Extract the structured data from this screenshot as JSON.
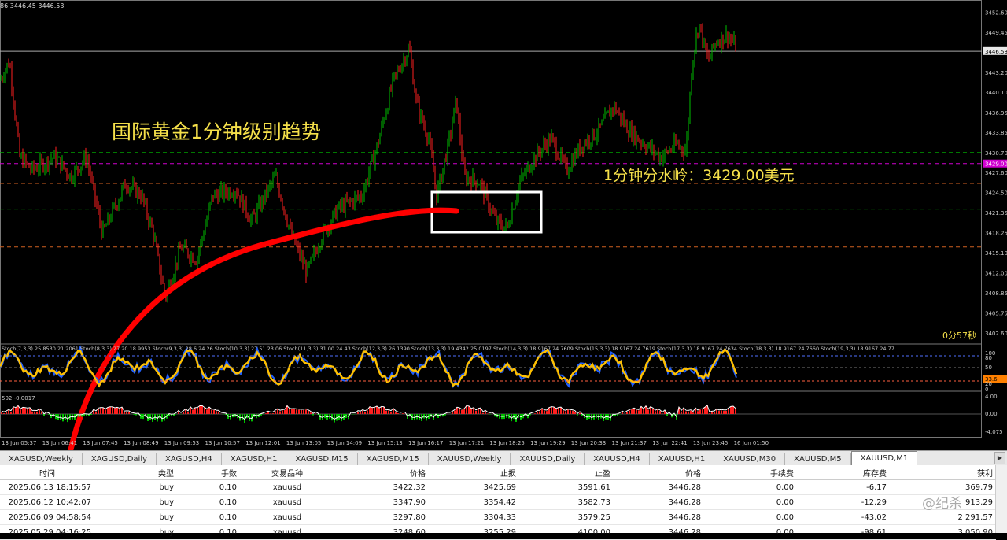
{
  "chart": {
    "top_info": "86 3446.45 3446.53",
    "annotation_title": "国际黄金1分钟级别趋势",
    "annotation_level": "1分钟分水岭：3429.00美元",
    "countdown": "0分57秒",
    "price_axis_labels": [
      "3452.60",
      "3449.45",
      "3446.53",
      "3443.20",
      "3440.10",
      "3436.95",
      "3433.85",
      "3430.70",
      "3429.00",
      "3427.60",
      "3424.50",
      "3421.35",
      "3418.25",
      "3415.10",
      "3412.00",
      "3408.85",
      "3405.75",
      "3402.60"
    ],
    "current_price": "3446.53",
    "level_price": "3429.00",
    "time_labels": [
      "13 Jun 05:37",
      "13 Jun 06:41",
      "13 Jun 07:45",
      "13 Jun 08:49",
      "13 Jun 09:53",
      "13 Jun 10:57",
      "13 Jun 12:01",
      "13 Jun 13:05",
      "13 Jun 14:09",
      "13 Jun 15:13",
      "13 Jun 16:17",
      "13 Jun 17:21",
      "13 Jun 18:25",
      "13 Jun 19:29",
      "13 Jun 20:33",
      "13 Jun 21:37",
      "13 Jun 22:41",
      "13 Jun 23:45",
      "16 Jun 01:50"
    ],
    "stoch_header": "Stoch(7,3,3) 25.8530 21.2061  Stoch(8,3,3) 27.20 18.9953  Stoch(9,3,3) 28.6 24.26  Stoch(10,3,3) 27.51 23.06  Stoch(11,3,3) 31.00 24.43  Stoch(12,3,3) 26.1390  Stoch(13,3,3) 19.4342 25.0197  Stoch(14,3,3) 18.9167 24.7609  Stoch(15,3,3) 18.9167 24.7619  Stoch(17,3,3) 18.9167 24.7634  Stoch(18,3,3) 18.9167 24.7660  Stoch(19,3,3) 18.9167 24.77",
    "stoch_axis": [
      "100",
      "80",
      "50",
      "33.6",
      "20",
      "0"
    ],
    "macd_header": "502 -0.0017",
    "macd_axis": [
      "4.00",
      "0.00",
      "-4.075"
    ],
    "colors": {
      "bull": "#00c000",
      "bear": "#ff2020",
      "stoch_main": "#ffc000",
      "stoch_signal": "#2060ff",
      "level_line": "#d000d0",
      "arrow": "#ff0000"
    }
  },
  "tabs": [
    "XAGUSD,Weekly",
    "XAGUSD,Daily",
    "XAGUSD,H4",
    "XAGUSD,H1",
    "XAGUSD,M15",
    "XAGUSD,M15",
    "XAUUSD,Weekly",
    "XAUUSD,Daily",
    "XAUUSD,H4",
    "XAUUSD,H1",
    "XAUUSD,M30",
    "XAUUSD,M5",
    "XAUUSD,M1"
  ],
  "active_tab": "XAUUSD,M1",
  "table": {
    "headers": [
      "时间",
      "类型",
      "手数",
      "交易品种",
      "价格",
      "止损",
      "止盈",
      "价格",
      "手续费",
      "库存费",
      "获利"
    ],
    "rows": [
      [
        "2025.06.13 18:15:57",
        "buy",
        "0.10",
        "xauusd",
        "3422.32",
        "3425.69",
        "3591.61",
        "3446.28",
        "0.00",
        "-6.17",
        "369.79"
      ],
      [
        "2025.06.12 10:42:07",
        "buy",
        "0.10",
        "xauusd",
        "3347.90",
        "3354.42",
        "3582.73",
        "3446.28",
        "0.00",
        "-12.29",
        "913.29"
      ],
      [
        "2025.06.09 04:58:54",
        "buy",
        "0.10",
        "xauusd",
        "3297.80",
        "3304.33",
        "3579.25",
        "3446.28",
        "0.00",
        "-43.02",
        "2 291.57"
      ],
      [
        "2025.05.29 04:16:25",
        "buy",
        "0.10",
        "xauusd",
        "3248.60",
        "3255.29",
        "4100.00",
        "3446.28",
        "0.00",
        "-98.61",
        "3 050.90"
      ]
    ]
  },
  "watermark": "@纪杀"
}
